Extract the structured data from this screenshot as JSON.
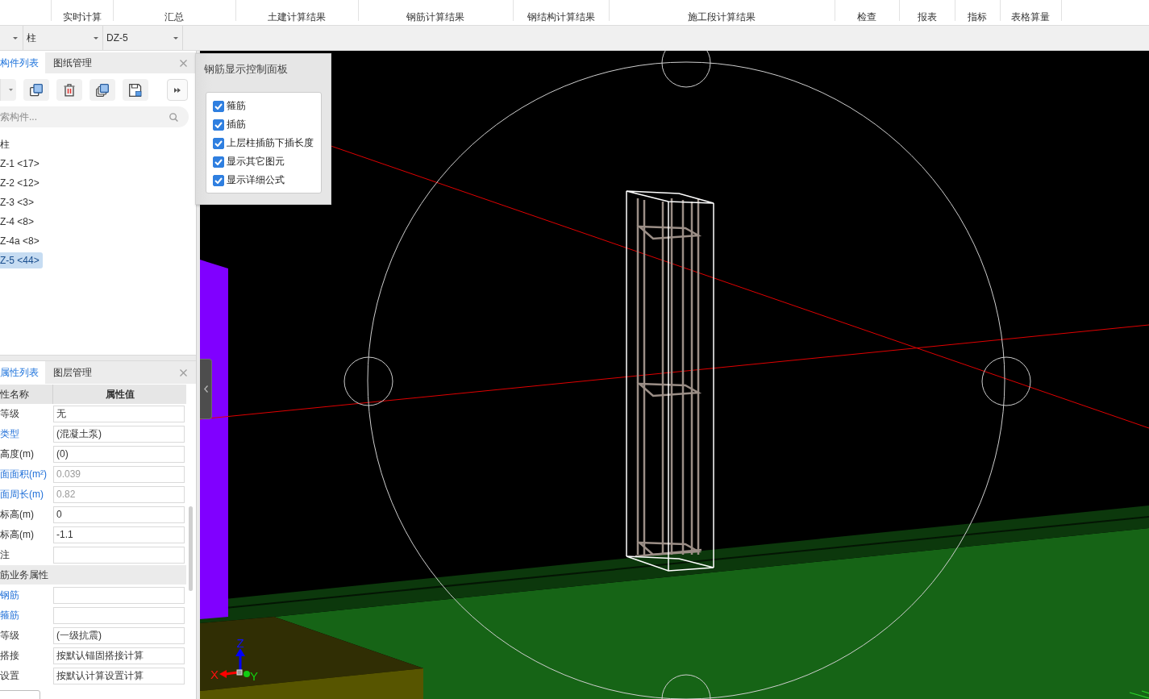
{
  "menu_bar": {
    "tabs": [
      "实时计算",
      "汇总",
      "土建计算结果",
      "钢筋计算结果",
      "钢结构计算结果",
      "施工段计算结果",
      "检查",
      "报表",
      "指标",
      "表格算量"
    ]
  },
  "filter_bar": {
    "dropdowns": [
      "柱",
      "DZ-5"
    ]
  },
  "component_panel": {
    "tabs": [
      {
        "label": "构件列表",
        "selected": true
      },
      {
        "label": "图纸管理",
        "selected": false
      }
    ],
    "search": {
      "placeholder": "索构件..."
    },
    "tree": [
      {
        "label": "柱",
        "selected": false,
        "children": [
          {
            "label": "Z-1 <17>",
            "selected": false
          },
          {
            "label": "Z-2 <12>",
            "selected": false
          },
          {
            "label": "Z-3 <3>",
            "selected": false
          },
          {
            "label": "Z-4 <8>",
            "selected": false
          },
          {
            "label": "Z-4a <8>",
            "selected": false
          },
          {
            "label": "Z-5 <44>",
            "selected": true
          }
        ]
      }
    ]
  },
  "control_panel": {
    "title": "钢筋显示控制面板",
    "options": [
      {
        "label": "箍筋",
        "checked": true
      },
      {
        "label": "插筋",
        "checked": true
      },
      {
        "label": "上层柱插筋下插长度",
        "checked": true
      },
      {
        "label": "显示其它图元",
        "checked": true
      },
      {
        "label": "显示详细公式",
        "checked": true
      }
    ]
  },
  "property_panel": {
    "tabs": [
      {
        "label": "属性列表",
        "selected": true
      },
      {
        "label": "图层管理",
        "selected": false
      }
    ],
    "columns": [
      "性名称",
      "属性值"
    ],
    "rows": [
      {
        "kind": "field",
        "name": "等级",
        "value": "无",
        "link": false,
        "readonly": false
      },
      {
        "kind": "field",
        "name": "类型",
        "value": "(混凝土泵)",
        "link": true,
        "readonly": false
      },
      {
        "kind": "field",
        "name": "高度(m)",
        "value": "(0)",
        "link": false,
        "readonly": false
      },
      {
        "kind": "field",
        "name": "面面积(m²)",
        "value": "0.039",
        "link": true,
        "readonly": true
      },
      {
        "kind": "field",
        "name": "面周长(m)",
        "value": "0.82",
        "link": true,
        "readonly": true
      },
      {
        "kind": "field",
        "name": "标高(m)",
        "value": "0",
        "link": false,
        "readonly": false
      },
      {
        "kind": "field",
        "name": "标高(m)",
        "value": "-1.1",
        "link": false,
        "readonly": false
      },
      {
        "kind": "field",
        "name": "注",
        "link": false
      },
      {
        "kind": "section",
        "name": "筋业务属性"
      },
      {
        "kind": "field",
        "name": "钢筋",
        "link": true
      },
      {
        "kind": "field",
        "name": "箍筋",
        "link": true
      },
      {
        "kind": "field",
        "name": "等级",
        "value": "(一级抗震)",
        "link": false,
        "readonly": false
      },
      {
        "kind": "field",
        "name": "搭接",
        "value": "按默认锚固搭接计算",
        "link": false,
        "readonly": false
      },
      {
        "kind": "field",
        "name": "设置",
        "value": "按默认计算设置计算",
        "link": false,
        "readonly": false
      }
    ]
  },
  "viewport": {
    "axis_labels": {
      "x": "X",
      "y": "Y",
      "z": "Z"
    }
  }
}
